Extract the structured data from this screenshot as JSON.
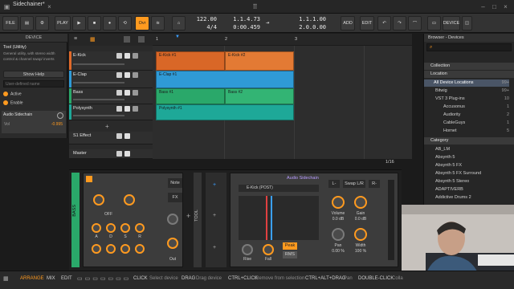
{
  "titlebar": {
    "document_tab": "Sidechainer*"
  },
  "toolbar": {
    "file": "FILE",
    "play": "PLAY",
    "ovr": "Ovr",
    "tempo": "122.00",
    "signature": "4/4",
    "position_bars": "1.1.4.73",
    "position_time": "0:00.459",
    "loop_start": "1.1.1.00",
    "loop_length": "2.0.0.00",
    "add": "ADD",
    "edit": "EDIT",
    "device": "DEVICE"
  },
  "device_panel": {
    "header": "DEVICE",
    "tool_name": "Tool (Utility)",
    "description": "General utility, with stereo width control & channel swap/ inverts",
    "show_help": "Show Help",
    "user_defined_name_placeholder": "User-defined name",
    "active_label": "Active",
    "enable_label": "Enable",
    "sidechain_label": "Audio Sidechain",
    "vol_label": "Vol",
    "vol_value": "-0.995"
  },
  "tracks": [
    {
      "name": "E-Kick",
      "color": "#e06a2a"
    },
    {
      "name": "E-Clap",
      "color": "#2f9ad6"
    },
    {
      "name": "Bass",
      "color": "#2aa86a"
    },
    {
      "name": "Polysynth",
      "color": "#1ea898"
    }
  ],
  "fx_track": {
    "name": "S1 Effect"
  },
  "master_track": {
    "name": "Master"
  },
  "arranger": {
    "ruler_labels": [
      "1",
      "2",
      "3"
    ],
    "zoom_label": "1/16",
    "clips": [
      {
        "label": "E-Kick #1",
        "track": 0,
        "color": "#d96727"
      },
      {
        "label": "E-Kick #2",
        "track": 0,
        "color": "#e37a34"
      },
      {
        "label": "E-Clap #1",
        "track": 1,
        "color": "#2f9ad6"
      },
      {
        "label": "Bass #1",
        "track": 2,
        "color": "#2aa86a"
      },
      {
        "label": "Bass #2",
        "track": 2,
        "color": "#33b474"
      },
      {
        "label": "Polysynth #1",
        "track": 3,
        "color": "#1ea898"
      }
    ]
  },
  "browser": {
    "title": "Browser - Devices",
    "collection_header": "Collection",
    "location_header": "Location",
    "locations": [
      {
        "label": "All Device Locations",
        "count": "99+"
      },
      {
        "label": "Bitwig",
        "count": "99+"
      },
      {
        "label": "VST 3 Plug-ins",
        "count": "10"
      },
      {
        "label": "Accusonus",
        "count": "1"
      },
      {
        "label": "Audiority",
        "count": "2"
      },
      {
        "label": "CableGuys",
        "count": "1"
      },
      {
        "label": "Hornet",
        "count": "5"
      }
    ],
    "category_header": "Category",
    "devices": [
      "AB_LM",
      "Absynth 5",
      "Absynth 5 FX",
      "Absynth 5 FX Surround",
      "Absynth 5 Stereo",
      "ADAPTIVERB",
      "Addictive Drums 2"
    ]
  },
  "device_chain": {
    "track_label": "BASS",
    "tool_label": "TOOL",
    "note_btn": "Note",
    "fx_btn": "FX",
    "off_label": "OFF",
    "out_label": "Out",
    "knob_labels_a": [
      "A",
      "D",
      "S",
      "R"
    ],
    "knob_labels_b": [
      "A",
      "D",
      "S",
      "R"
    ],
    "sidechain_title": "Audio Sidechain",
    "sidechain_source": "E-Kick (POST)",
    "rise": "Rise",
    "fall": "Fall",
    "peak": "Peak",
    "rms": "RMS",
    "l_btn": "L-",
    "swap_btn": "Swap L/R",
    "r_btn": "R-",
    "volume_label": "Volume",
    "volume_value": "0.0 dB",
    "gain_label": "Gain",
    "gain_value": "0.0 dB",
    "pan_label": "Pan",
    "pan_value": "0.00 %",
    "width_label": "Width",
    "width_value": "100 %"
  },
  "statusbar": {
    "arrange": "ARRANGE",
    "mix": "MIX",
    "edit": "EDIT",
    "click": "CLICK",
    "click_desc": "Select device",
    "drag": "DRAG",
    "drag_desc": "Drag device",
    "ctrl_click": "CTRL+CLICK",
    "ctrl_click_desc": "Remove from selection",
    "ctrl_alt_drag": "CTRL+ALT+DRAG",
    "pan_desc": "Pan",
    "double_click": "DOUBLE-CLICK",
    "collapse_desc": "Colla"
  }
}
